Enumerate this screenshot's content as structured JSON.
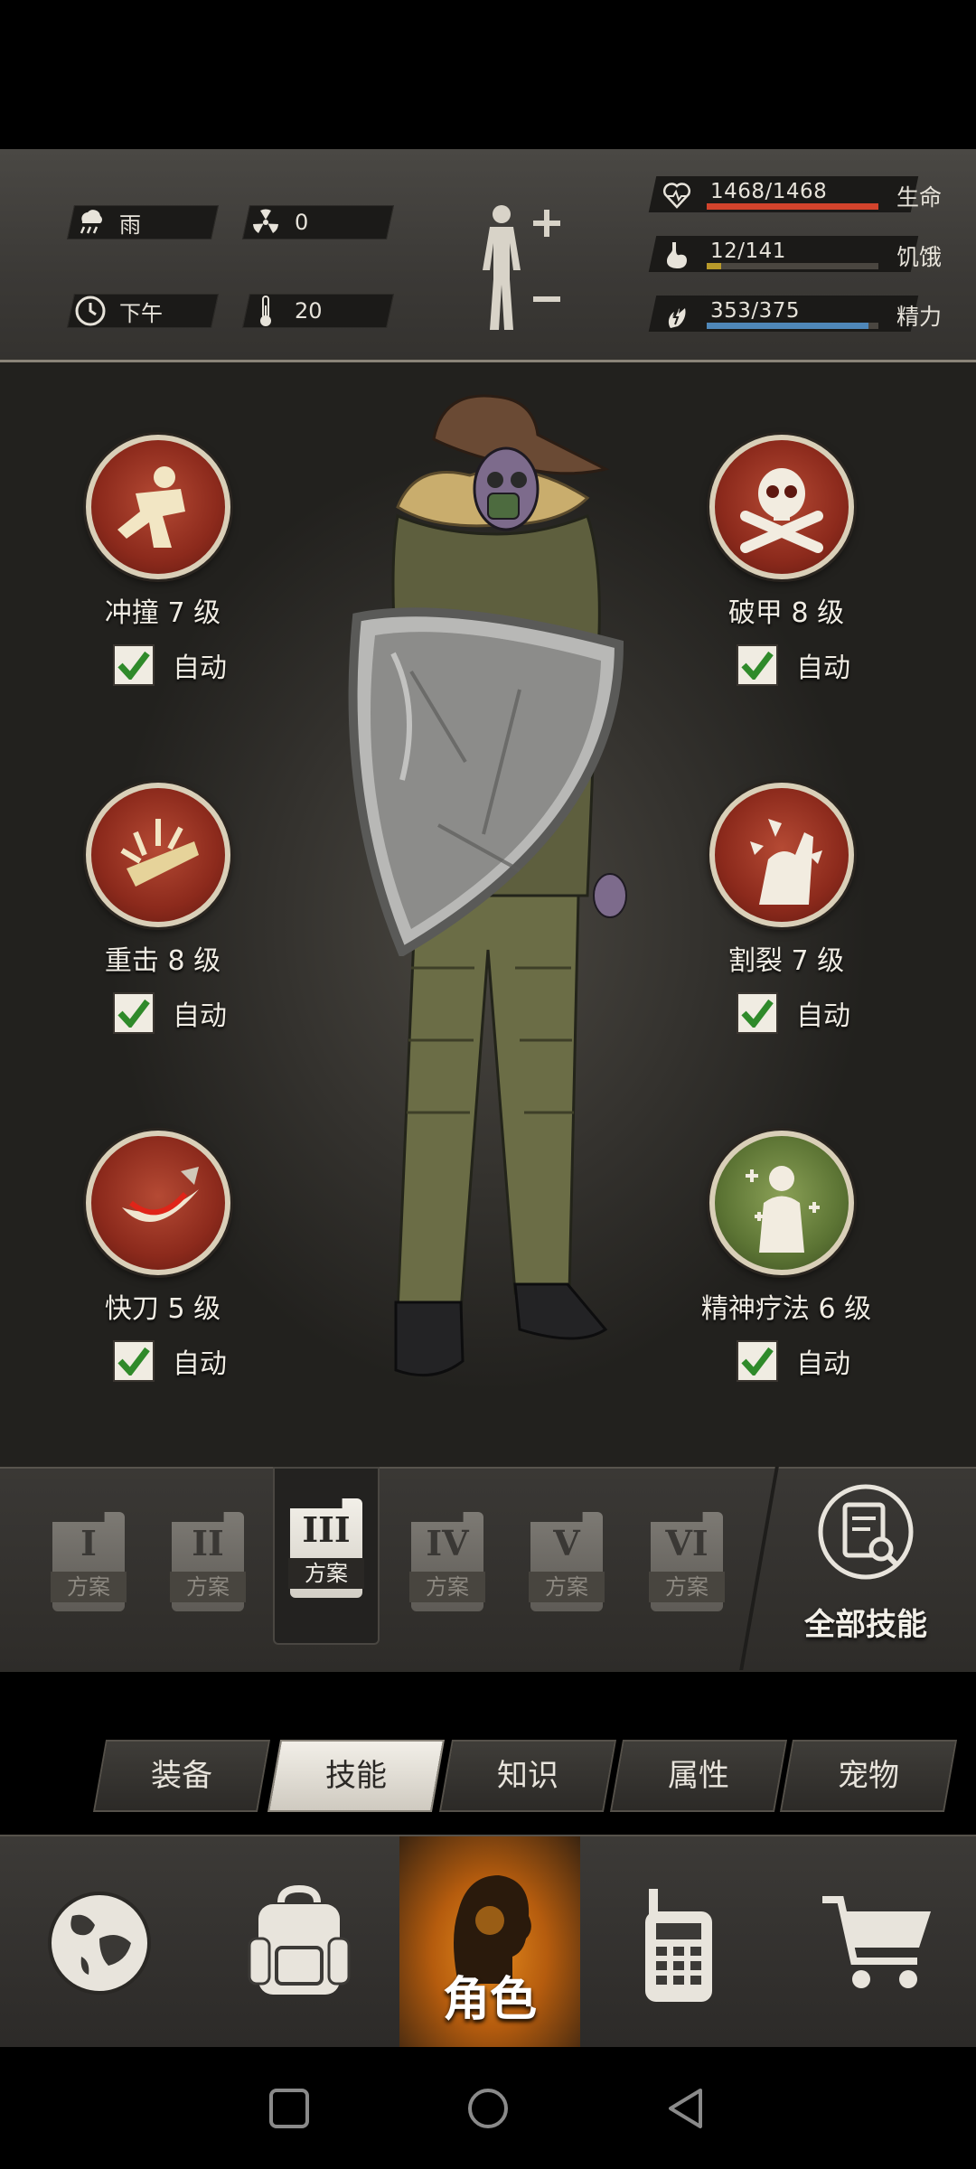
{
  "environment": {
    "weather": "雨",
    "radiation": "0",
    "time_of_day": "下午",
    "temperature": "20"
  },
  "stats": [
    {
      "icon": "heart-icon",
      "value": "1468/1468",
      "label": "生命",
      "fraction": 1.0,
      "color": "#d2432c"
    },
    {
      "icon": "stomach-icon",
      "value": "12/141",
      "label": "饥饿",
      "fraction": 0.085,
      "color": "#b89a2a"
    },
    {
      "icon": "energy-icon",
      "value": "353/375",
      "label": "精力",
      "fraction": 0.94,
      "color": "#4f87b8"
    }
  ],
  "skills": {
    "left": [
      {
        "name": "冲撞 7 级",
        "auto": "自动",
        "checked": true,
        "icon": "charge-icon"
      },
      {
        "name": "重击 8 级",
        "auto": "自动",
        "checked": true,
        "icon": "heavy-strike-icon"
      },
      {
        "name": "快刀 5 级",
        "auto": "自动",
        "checked": true,
        "icon": "quick-blade-icon"
      }
    ],
    "right": [
      {
        "name": "破甲 8 级",
        "auto": "自动",
        "checked": true,
        "icon": "skull-crossbones-icon"
      },
      {
        "name": "割裂 7 级",
        "auto": "自动",
        "checked": true,
        "icon": "lacerate-icon"
      },
      {
        "name": "精神疗法 6 级",
        "auto": "自动",
        "checked": true,
        "icon": "mind-therapy-icon"
      }
    ]
  },
  "plans": [
    {
      "numeral": "I",
      "label": "方案"
    },
    {
      "numeral": "II",
      "label": "方案"
    },
    {
      "numeral": "III",
      "label": "方案",
      "active": true
    },
    {
      "numeral": "IV",
      "label": "方案"
    },
    {
      "numeral": "V",
      "label": "方案"
    },
    {
      "numeral": "VI",
      "label": "方案"
    }
  ],
  "all_skills_label": "全部技能",
  "tabs": [
    {
      "label": "装备"
    },
    {
      "label": "技能",
      "active": true
    },
    {
      "label": "知识"
    },
    {
      "label": "属性"
    },
    {
      "label": "宠物"
    }
  ],
  "bottom_nav": {
    "role_label": "角色",
    "items": [
      "globe-icon",
      "backpack-icon",
      "role-icon",
      "radio-icon",
      "cart-icon"
    ]
  }
}
